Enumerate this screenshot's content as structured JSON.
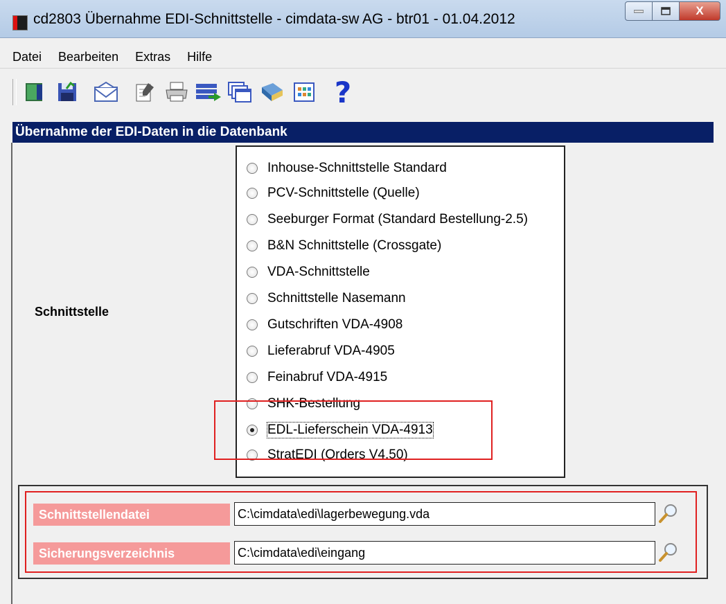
{
  "window": {
    "title": "cd2803 Übernahme EDI-Schnittstelle - cimdata-sw AG - btr01 - 01.04.2012",
    "controls": {
      "minimize_icon": "minimize-icon",
      "maximize_icon": "maximize-icon",
      "close": "X"
    }
  },
  "menu": {
    "items": [
      "Datei",
      "Bearbeiten",
      "Extras",
      "Hilfe"
    ]
  },
  "toolbar": {
    "icons": [
      "exit-door-icon",
      "save-disk-icon",
      "mail-envelope-icon",
      "edit-document-icon",
      "print-icon",
      "transfer-icon",
      "windows-icon",
      "book-icon",
      "grid-calendar-icon",
      "help-icon"
    ],
    "help_glyph": "?"
  },
  "section": {
    "title": "Übernahme der EDI-Daten in die Datenbank"
  },
  "schnittstelle": {
    "label": "Schnittstelle",
    "options": [
      "Inhouse-Schnittstelle Standard",
      "PCV-Schnittstelle (Quelle)",
      "Seeburger Format (Standard Bestellung-2.5)",
      "B&N Schnittstelle (Crossgate)",
      "VDA-Schnittstelle",
      "Schnittstelle Nasemann",
      "Gutschriften VDA-4908",
      "Lieferabruf VDA-4905",
      "Feinabruf VDA-4915",
      "SHK-Bestellung",
      "EDL-Lieferschein VDA-4913",
      "StratEDI (Orders V4.50)"
    ],
    "selected": "EDL-Lieferschein VDA-4913"
  },
  "files": {
    "schnittstellendatei": {
      "label": "Schnittstellendatei",
      "value": "C:\\cimdata\\edi\\lagerbewegung.vda"
    },
    "sicherungsverzeichnis": {
      "label": "Sicherungsverzeichnis",
      "value": "C:\\cimdata\\edi\\eingang"
    }
  },
  "colors": {
    "header_bg": "#081f66",
    "label_bg": "#f59a9a",
    "highlight": "#e02020"
  }
}
